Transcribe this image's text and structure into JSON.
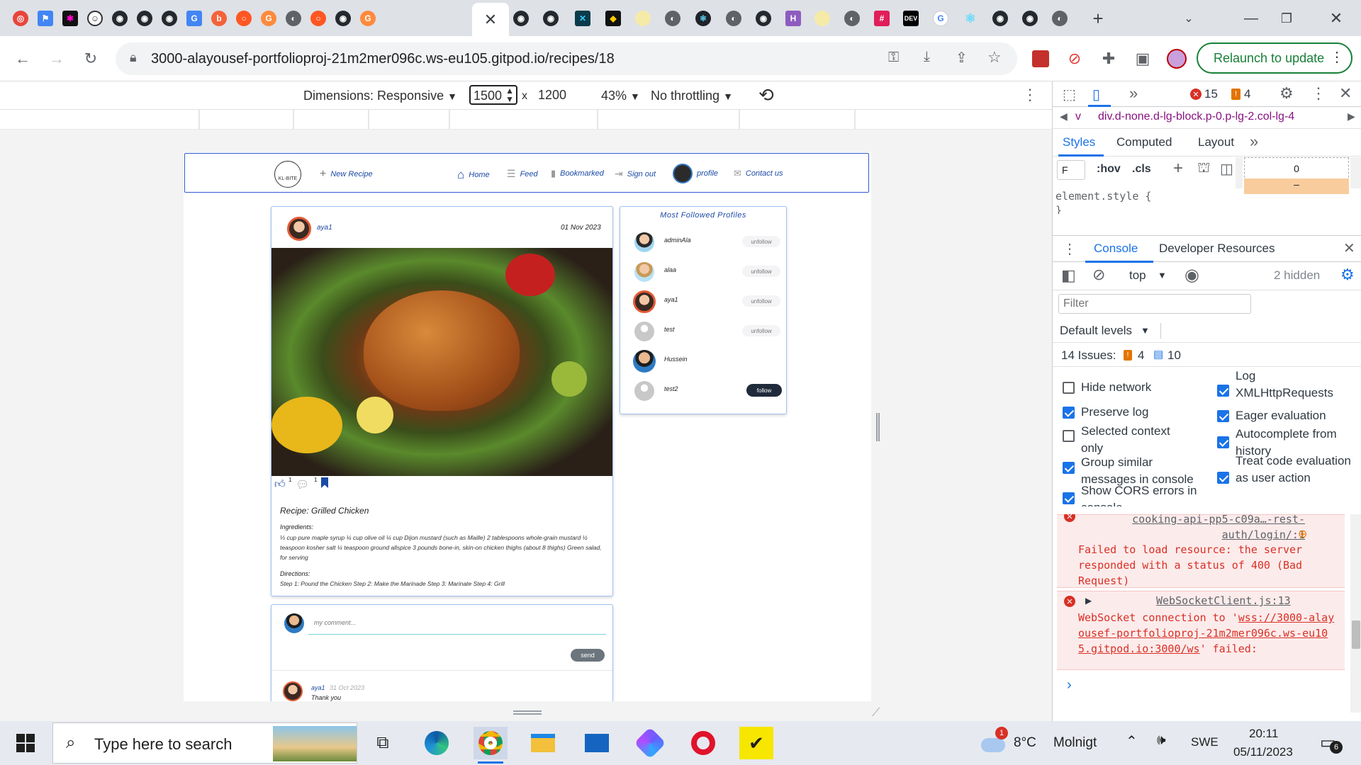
{
  "browser": {
    "url": "3000-alayousef-portfolioproj-21m2mer096c.ws-eu105.gitpod.io/recipes/18",
    "relaunch_label": "Relaunch to update",
    "active_tab_close": "✕"
  },
  "device_toolbar": {
    "dimensions_label": "Dimensions: Responsive",
    "width": "1500",
    "times": "x",
    "height": "1200",
    "zoom": "43%",
    "throttling": "No throttling"
  },
  "site": {
    "logo_text": "KL-BITE",
    "nav": {
      "new_recipe": "New Recipe",
      "home": "Home",
      "feed": "Feed",
      "bookmarked": "Bookmarked",
      "sign_out": "Sign out",
      "profile": "profile",
      "contact": "Contact us"
    },
    "post": {
      "author": "aya1",
      "date": "01 Nov 2023",
      "likes": "1",
      "comments": "1",
      "title": "Recipe: Grilled Chicken",
      "ingredients_label": "Ingredients:",
      "ingredients": "⅓ cup pure maple syrup ¼ cup olive oil ¼ cup Dijon mustard (such as Maille) 2 tablespoons whole-grain mustard ½ teaspoon kosher salt ¼ teaspoon ground allspice 3 pounds bone-in, skin-on chicken thighs (about 8 thighs) Green salad, for serving",
      "directions_label": "Directions:",
      "directions": "Step 1: Pound the Chicken Step 2: Make the Marinade Step 3: Marinate Step 4: Grill"
    },
    "comment_box": {
      "placeholder": "my comment...",
      "send_label": "send"
    },
    "comment": {
      "author": "aya1",
      "date": "31 Oct 2023",
      "text": "Thank you"
    },
    "followed": {
      "title": "Most Followed Profiles",
      "profiles": [
        {
          "name": "adminAla",
          "action": "unfollow"
        },
        {
          "name": "alaa",
          "action": "unfollow"
        },
        {
          "name": "aya1",
          "action": "unfollow"
        },
        {
          "name": "test",
          "action": "unfollow"
        },
        {
          "name": "Hussein",
          "action": ""
        },
        {
          "name": "test2",
          "action": "follow"
        }
      ]
    }
  },
  "devtools": {
    "errors": "15",
    "warnings": "4",
    "breadcrumb": "div.d-none.d-lg-block.p-0.p-lg-2.col-lg-4",
    "breadcrumb_prefix": "v",
    "panel_tabs": [
      "Styles",
      "Computed",
      "Layout"
    ],
    "filter_short": "F",
    "hov": ":hov",
    "cls": ".cls",
    "element_style": "element.style {",
    "element_style_close": "}",
    "box_value": "0",
    "box_dash": "–",
    "drawer_tabs": [
      "Console",
      "Developer Resources"
    ],
    "context": "top",
    "hidden": "2 hidden",
    "filter_placeholder": "Filter",
    "levels": "Default levels",
    "issues_label": "14 Issues:",
    "issues_warn": "4",
    "issues_info": "10",
    "settings_left": [
      {
        "label": "Hide network",
        "checked": false
      },
      {
        "label": "Preserve log",
        "checked": true
      },
      {
        "label": "Selected context only",
        "checked": false
      },
      {
        "label": "Group similar messages in console",
        "checked": true
      },
      {
        "label": "Show CORS errors in console",
        "checked": true
      }
    ],
    "settings_right": [
      {
        "label": "Log XMLHttpRequests",
        "checked": true
      },
      {
        "label": "Eager evaluation",
        "checked": true
      },
      {
        "label": "Autocomplete from history",
        "checked": true
      },
      {
        "label": "Treat code evaluation as user action",
        "checked": true
      }
    ],
    "console": {
      "err1_link": "cooking-api-pp5-c09a…-rest-auth/login/:1",
      "err1_text": "Failed to load resource: the server responded with a status of 400 (Bad Request)",
      "err2_link": "WebSocketClient.js:13",
      "err2_text_prefix": "WebSocket connection to '",
      "err2_url": "wss://3000-alayousef-portfolioproj-21m2mer096c.ws-eu105.gitpod.io:3000/ws",
      "err2_text_suffix": "' failed:",
      "prompt": "›"
    }
  },
  "taskbar": {
    "search_placeholder": "Type here to search",
    "weather_temp": "8°C",
    "weather_desc": "Molnigt",
    "weather_badge": "1",
    "language": "SWE",
    "time": "20:11",
    "date": "05/11/2023",
    "notifications": "6"
  }
}
